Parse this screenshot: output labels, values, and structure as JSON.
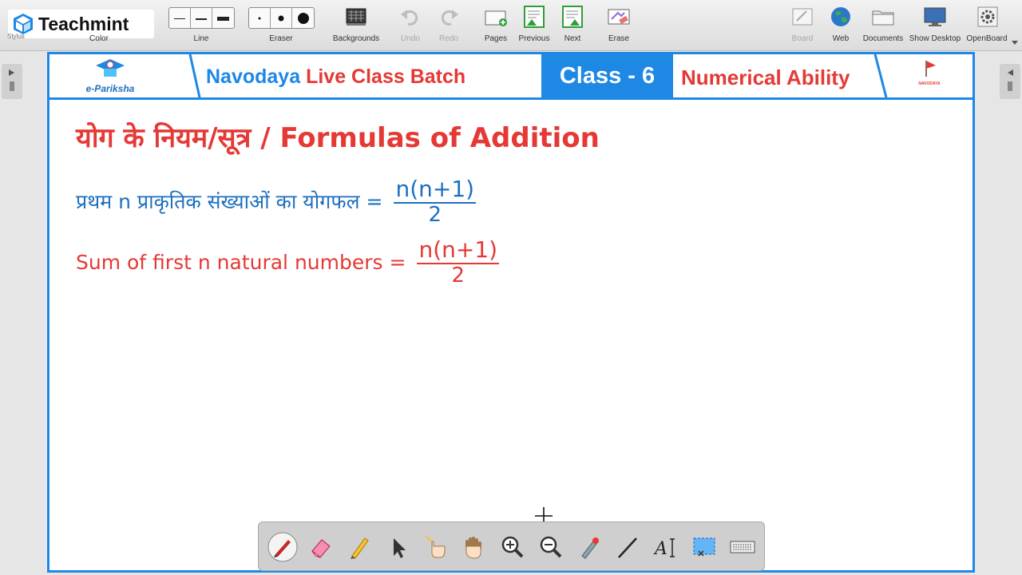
{
  "app": {
    "logo_text": "Teachmint",
    "cut_label": "Stylus"
  },
  "toolbar": {
    "color_label": "Color",
    "line_label": "Line",
    "eraser_label": "Eraser",
    "backgrounds_label": "Backgrounds",
    "undo_label": "Undo",
    "redo_label": "Redo",
    "pages_label": "Pages",
    "previous_label": "Previous",
    "next_label": "Next",
    "erase_label": "Erase",
    "board_label": "Board",
    "web_label": "Web",
    "documents_label": "Documents",
    "show_desktop_label": "Show Desktop",
    "openboard_label": "OpenBoard"
  },
  "banner": {
    "brand": "e-Pariksha",
    "batch_part1": "Navodaya",
    "batch_part2": "Live Class Batch",
    "class_label": "Class - 6",
    "subject": "Numerical Ability",
    "right_logo": "NAVODAYA"
  },
  "content": {
    "heading": "योग के नियम/सूत्र  / Formulas of Addition",
    "formula_hindi": "प्रथम n प्राकृतिक संख्याओं का योगफल =",
    "formula_english": "Sum of first n natural numbers =",
    "numerator": "n(n+1)",
    "denominator": "2"
  },
  "colors": {
    "accent_blue": "#1e88e5",
    "heading_red": "#e53935",
    "hindi_formula_blue": "#1e6fc0"
  },
  "palette_tools": [
    "pen-icon",
    "eraser-icon",
    "highlighter-icon",
    "pointer-icon",
    "laser-hand-icon",
    "hand-icon",
    "zoom-in-icon",
    "zoom-out-icon",
    "laser-pointer-icon",
    "line-icon",
    "text-icon",
    "capture-icon",
    "keyboard-icon"
  ]
}
